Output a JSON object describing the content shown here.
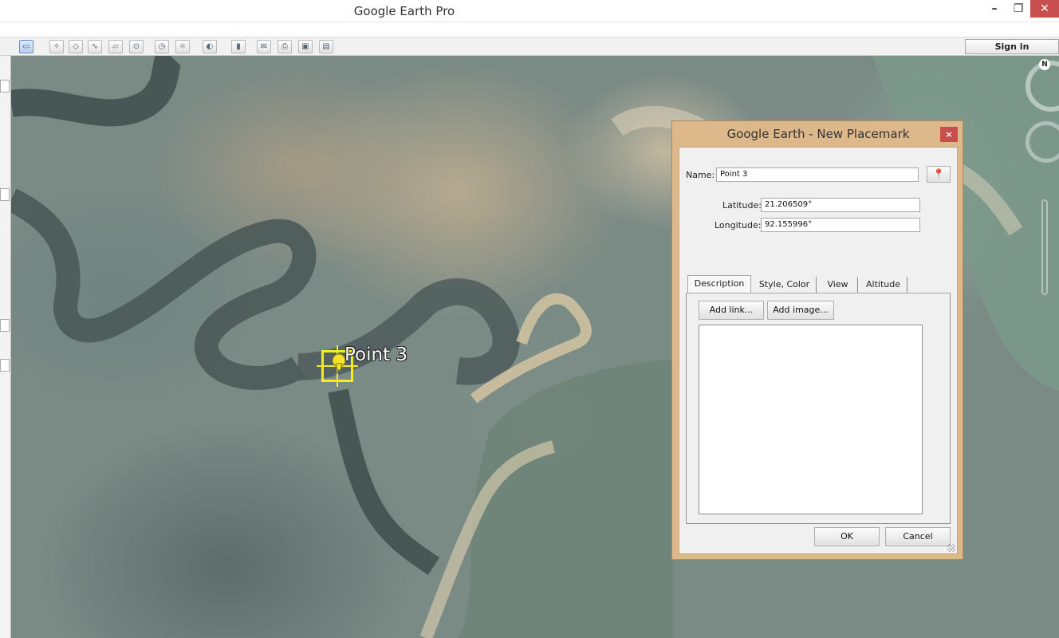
{
  "window": {
    "title": "Google Earth Pro",
    "minimize": "–",
    "maximize": "❐",
    "close": "✕"
  },
  "toolbar": {
    "sign_in": "Sign in",
    "icons": [
      "sidebar-icon",
      "placemark-icon",
      "polygon-icon",
      "path-icon",
      "overlay-icon",
      "tour-icon",
      "historical-imagery-icon",
      "sunlight-icon",
      "planets-icon",
      "ruler-icon",
      "email-icon",
      "print-icon",
      "save-image-icon",
      "maps-icon"
    ]
  },
  "map": {
    "placemark_label": "Point 3",
    "compass_letter": "N"
  },
  "dialog": {
    "title": "Google Earth - New Placemark",
    "close": "×",
    "name_label": "Name:",
    "name_value": "Point 3",
    "latitude_label": "Latitude:",
    "latitude_value": "21.206509°",
    "longitude_label": "Longitude:",
    "longitude_value": "92.155996°",
    "tabs": [
      {
        "label": "Description",
        "active": true
      },
      {
        "label": "Style, Color",
        "active": false
      },
      {
        "label": "View",
        "active": false
      },
      {
        "label": "Altitude",
        "active": false
      }
    ],
    "add_link": "Add link...",
    "add_image": "Add image...",
    "ok": "OK",
    "cancel": "Cancel"
  }
}
